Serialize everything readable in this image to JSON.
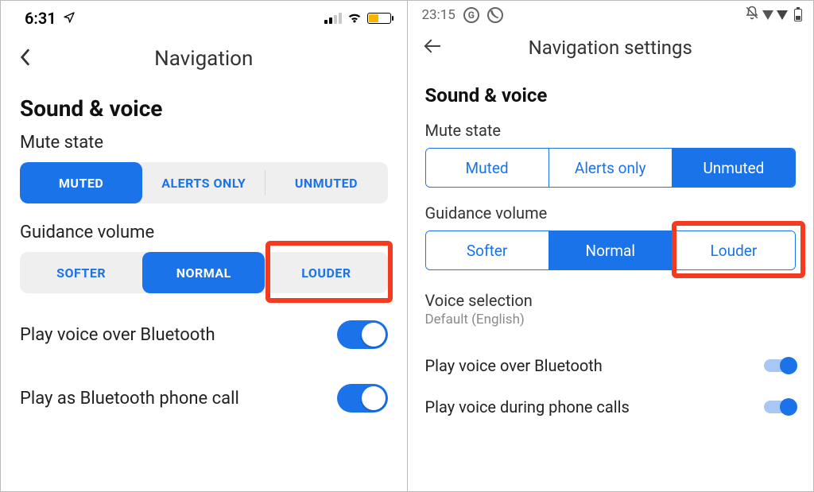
{
  "ios": {
    "status": {
      "time": "6:31"
    },
    "header": {
      "title": "Navigation"
    },
    "section": "Sound & voice",
    "mute": {
      "label": "Mute state",
      "options": [
        "MUTED",
        "ALERTS ONLY",
        "UNMUTED"
      ],
      "selected": 0
    },
    "guidance": {
      "label": "Guidance volume",
      "options": [
        "SOFTER",
        "NORMAL",
        "LOUDER"
      ],
      "selected": 1
    },
    "rows": {
      "bt_voice": "Play voice over Bluetooth",
      "bt_call": "Play as Bluetooth phone call"
    }
  },
  "android": {
    "status": {
      "time": "23:15"
    },
    "header": {
      "title": "Navigation settings"
    },
    "section": "Sound & voice",
    "mute": {
      "label": "Mute state",
      "options": [
        "Muted",
        "Alerts only",
        "Unmuted"
      ],
      "selected": 2
    },
    "guidance": {
      "label": "Guidance volume",
      "options": [
        "Softer",
        "Normal",
        "Louder"
      ],
      "selected": 1
    },
    "voice_selection": {
      "label": "Voice selection",
      "value": "Default (English)"
    },
    "rows": {
      "bt_voice": "Play voice over Bluetooth",
      "during_calls": "Play voice during phone calls"
    }
  }
}
